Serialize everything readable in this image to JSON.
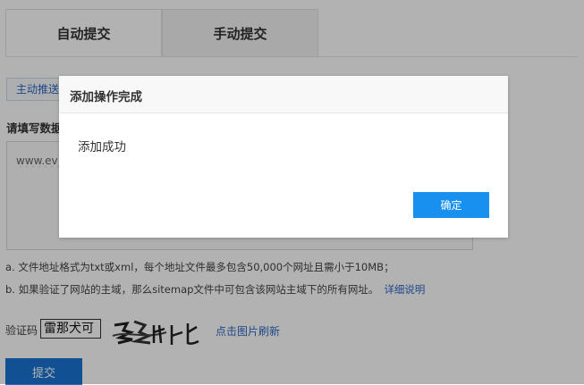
{
  "tabs": [
    {
      "label": "自动提交",
      "active": true
    },
    {
      "label": "手动提交",
      "active": false
    }
  ],
  "push_pill": {
    "label": "主动推送"
  },
  "form": {
    "section_label": "请填写数据",
    "url_value": "www.ev1",
    "notes": {
      "a": "a. 文件地址格式为txt或xml，每个地址文件最多包含50,000个网址且需小于10MB；",
      "b": "b. 如果验证了网站的主域，那么sitemap文件中可包含该网站主域下的所有网址。",
      "b_link": "详细说明"
    },
    "captcha_label": "验证码",
    "captcha_value": "雷那犬可",
    "refresh_link": "点击图片刷新",
    "submit_label": "提交"
  },
  "dialog": {
    "title": "添加操作完成",
    "message": "添加成功",
    "confirm_label": "确定"
  },
  "colors": {
    "accent": "#1890f0",
    "submit": "#1b73d4",
    "link": "#2d67c2",
    "mask": "rgba(0,0,0,0.30)"
  }
}
